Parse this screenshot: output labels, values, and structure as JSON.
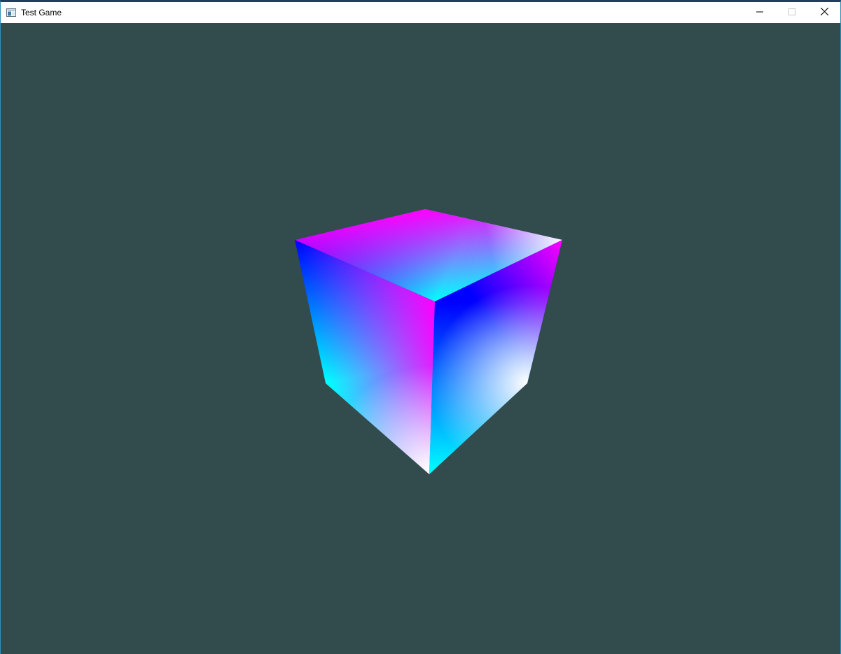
{
  "window": {
    "title": "Test Game",
    "icon": "app-window-icon",
    "controls": {
      "minimize": "minimize-icon",
      "maximize": "maximize-icon",
      "close": "close-icon"
    }
  },
  "scene": {
    "object": "cube",
    "background_color": "#324b4c",
    "vertex_colors": [
      "#0000ff",
      "#ff00ff",
      "#00ffff",
      "#ffffff"
    ]
  }
}
